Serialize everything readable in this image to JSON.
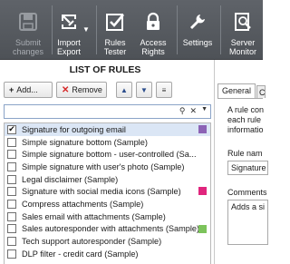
{
  "toolbar": {
    "buttons": [
      {
        "label": "Submit\nchanges",
        "icon": "save-icon",
        "enabled": false
      },
      {
        "label": "Import\nExport",
        "icon": "import-export-icon",
        "enabled": true
      },
      {
        "label": "Rules\nTester",
        "icon": "checkbox-tester-icon",
        "enabled": true
      },
      {
        "label": "Access\nRights",
        "icon": "lock-icon",
        "enabled": true
      },
      {
        "label": "Settings",
        "icon": "wrench-icon",
        "enabled": true
      },
      {
        "label": "Server\nMonitor",
        "icon": "server-monitor-icon",
        "enabled": true
      }
    ]
  },
  "list_panel": {
    "title": "LIST OF RULES",
    "add_label": "Add...",
    "add_icon": "plus-icon",
    "remove_label": "Remove",
    "remove_icon": "x-icon",
    "move_up_icon": "chevron-up-icon",
    "move_down_icon": "chevron-down-icon",
    "menu_icon": "menu-icon",
    "search": {
      "value": "",
      "placeholder": ""
    },
    "rules": [
      {
        "label": "Signature for outgoing email",
        "checked": true,
        "selected": true,
        "marker_color": "#8c63b5"
      },
      {
        "label": "Simple signature bottom (Sample)",
        "checked": false
      },
      {
        "label": "Simple signature bottom - user-controlled (Sa...",
        "checked": false
      },
      {
        "label": "Simple signature with user's photo (Sample)",
        "checked": false
      },
      {
        "label": "Legal disclaimer (Sample)",
        "checked": false
      },
      {
        "label": "Signature with social media icons (Sample)",
        "checked": false,
        "marker_color": "#e0257d"
      },
      {
        "label": "Compress attachments (Sample)",
        "checked": false
      },
      {
        "label": "Sales email with attachments (Sample)",
        "checked": false
      },
      {
        "label": "Sales autoresponder with attachments (Sample)",
        "checked": false,
        "marker_color": "#7cc35b"
      },
      {
        "label": "Tech support autoresponder (Sample)",
        "checked": false
      },
      {
        "label": "DLP filter - credit card (Sample)",
        "checked": false
      }
    ]
  },
  "right_panel": {
    "tabs": [
      "General",
      "C"
    ],
    "description_lines": [
      "A rule con",
      "each rule",
      "informatio"
    ],
    "rule_name_label": "Rule nam",
    "rule_name_value": "Signature",
    "comments_label": "Comments",
    "comments_value": "Adds a si"
  },
  "colors": {
    "toolbar_bg": "#575b60",
    "selection_bg": "#dbe6f5",
    "remove_icon": "#d62828"
  }
}
